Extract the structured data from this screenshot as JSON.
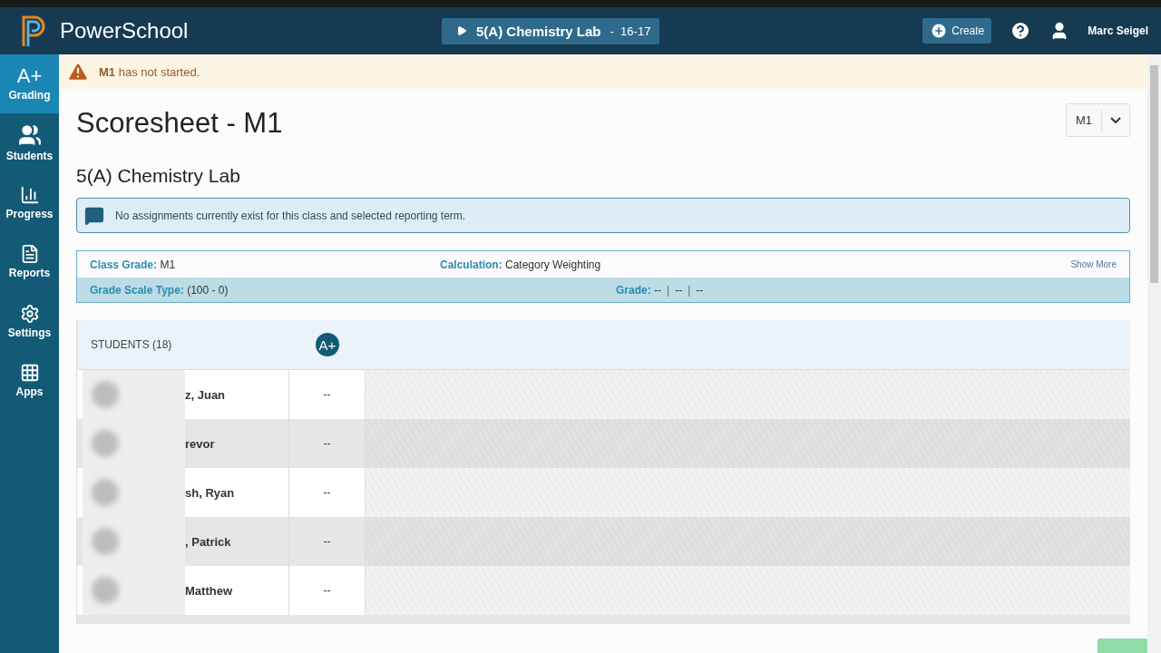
{
  "header": {
    "app_name": "PowerSchool",
    "class_selector": {
      "label": "5(A) Chemistry Lab",
      "separator": "-",
      "term": "16-17"
    },
    "create_button": "Create",
    "user_name": "Marc Seigel"
  },
  "sidebar": {
    "items": [
      {
        "kind": "grading",
        "icon_text": "A+",
        "label": "Grading",
        "selected": true
      },
      {
        "kind": "students",
        "label": "Students",
        "selected": false
      },
      {
        "kind": "progress",
        "label": "Progress",
        "selected": false
      },
      {
        "kind": "reports",
        "label": "Reports",
        "selected": false
      },
      {
        "kind": "settings",
        "label": "Settings",
        "selected": false
      },
      {
        "kind": "apps",
        "label": "Apps",
        "selected": false
      }
    ]
  },
  "alert": {
    "text": "**M1** has not started."
  },
  "page_title": "Scoresheet - M1",
  "term_selector": "M1",
  "class_title": "5(A) Chemistry Lab",
  "info_message": "No assignments currently exist for this class and selected reporting term.",
  "class_info": {
    "class_grade": {
      "label": "Class Grade:",
      "value": "M1"
    },
    "calculation": {
      "label": "Calculation:",
      "value": "Category Weighting"
    },
    "show_more": "Show More",
    "grade_scale_type": {
      "label": "Grade Scale Type:",
      "value": "(100 - 0)"
    },
    "grade": {
      "label": "Grade:",
      "values": [
        "--",
        "--",
        "--"
      ],
      "separator": "|"
    }
  },
  "scoresheet": {
    "students_header": "STUDENTS (18)",
    "column_icon_text": "A+",
    "rows": [
      {
        "name": "z, Juan",
        "score": "--"
      },
      {
        "name": "revor",
        "score": "--"
      },
      {
        "name": "sh, Ryan",
        "score": "--"
      },
      {
        "name": ", Patrick",
        "score": "--"
      },
      {
        "name": "Matthew",
        "score": "--"
      }
    ]
  }
}
